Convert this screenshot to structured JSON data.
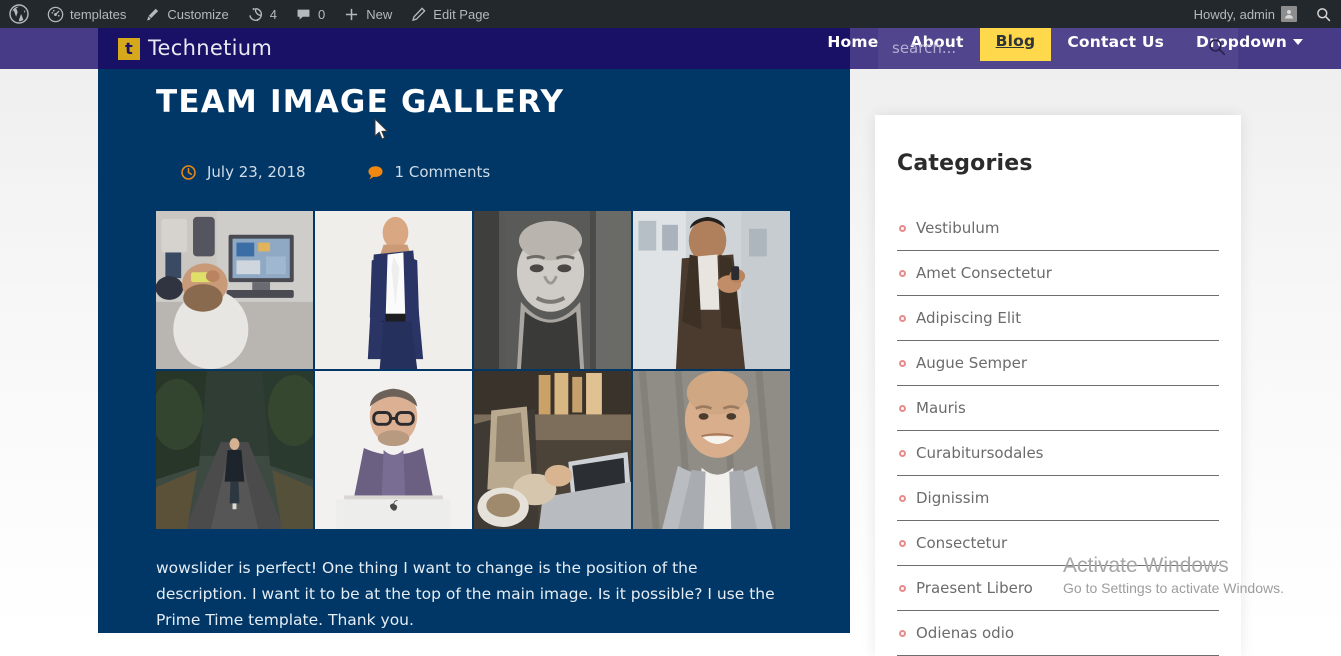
{
  "adminbar": {
    "wp_logo": "wordpress-logo-icon",
    "items": [
      {
        "icon": "dashboard-icon",
        "label": "templates"
      },
      {
        "icon": "brush-icon",
        "label": "Customize"
      },
      {
        "icon": "revisions-icon",
        "label": "4"
      },
      {
        "icon": "comment-icon",
        "label": "0"
      },
      {
        "icon": "plus-icon",
        "label": "New"
      },
      {
        "icon": "pencil-icon",
        "label": "Edit Page"
      }
    ],
    "howdy": "Howdy, admin",
    "search_icon": "search-icon"
  },
  "header": {
    "logo_mark": "t",
    "logo_text": "Technetium",
    "nav": [
      {
        "label": "Home",
        "active": false,
        "caret": false
      },
      {
        "label": "About",
        "active": false,
        "caret": false
      },
      {
        "label": "Blog",
        "active": true,
        "caret": false
      },
      {
        "label": "Contact Us",
        "active": false,
        "caret": false
      },
      {
        "label": "Dropdown",
        "active": false,
        "caret": true
      }
    ],
    "search": {
      "placeholder": "search...",
      "value": "",
      "button_icon": "search-icon"
    }
  },
  "main": {
    "title": "TEAM IMAGE GALLERY",
    "meta": {
      "date_icon": "clock-icon",
      "date": "July 23, 2018",
      "comments_icon": "comment-bubble-icon",
      "comments": "1 Comments"
    },
    "gallery": [
      {
        "name": "office-man-sticky-notes"
      },
      {
        "name": "man-blue-suit-standing"
      },
      {
        "name": "bw-portrait-man"
      },
      {
        "name": "man-leather-jacket-phone"
      },
      {
        "name": "man-on-forest-road"
      },
      {
        "name": "man-glasses-imac"
      },
      {
        "name": "person-laptop-cafe"
      },
      {
        "name": "smiling-bald-man-grey-blazer"
      }
    ],
    "body_text": "wowslider is perfect! One thing I want to change is the position of the description. I want it to be at the top of the main image. Is it possible? I use the Prime Time template. Thank you."
  },
  "sidebar": {
    "widget_title": "Categories",
    "categories": [
      "Vestibulum",
      "Amet Consectetur",
      "Adipiscing Elit",
      "Augue Semper",
      "Mauris",
      "Curabitursodales",
      "Dignissim",
      "Consectetur",
      "Praesent Libero",
      "Odienas odio"
    ]
  },
  "watermark": {
    "title": "Activate Windows",
    "subtitle": "Go to Settings to activate Windows."
  },
  "colors": {
    "adminbar_bg": "#23282d",
    "header_purple": "#473a87",
    "logo_block": "#191166",
    "content_blue": "#003767",
    "accent_yellow": "#ffd740",
    "accent_orange": "#f0880f",
    "bullet_pink": "#e98b8b"
  }
}
